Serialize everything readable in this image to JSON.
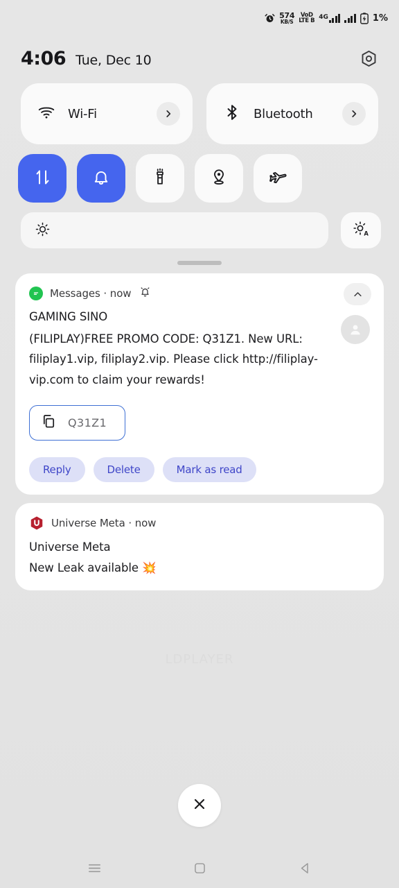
{
  "status_bar": {
    "alarm_icon": "alarm-clock-icon",
    "network_speed_value": "574",
    "network_speed_unit": "KB/S",
    "volte_line1": "VoD",
    "volte_line2": "LTE B",
    "network_type": "4G",
    "signal_icon_primary": "signal-bars-icon",
    "signal_icon_secondary": "signal-bars-icon",
    "battery_icon": "battery-charging-icon",
    "battery_level": "1%"
  },
  "header": {
    "time": "4:06",
    "date": "Tue, Dec 10",
    "settings_icon": "gear-icon"
  },
  "quick_settings": {
    "big_tiles": [
      {
        "label": "Wi-Fi",
        "icon": "wifi-icon",
        "active": false,
        "chevron_icon": "chevron-right-icon"
      },
      {
        "label": "Bluetooth",
        "icon": "bluetooth-icon",
        "active": false,
        "chevron_icon": "chevron-right-icon"
      }
    ],
    "toggles": [
      {
        "name": "mobile-data",
        "icon": "data-transfer-icon",
        "active": true
      },
      {
        "name": "ringer",
        "icon": "bell-icon",
        "active": true
      },
      {
        "name": "flashlight",
        "icon": "flashlight-icon",
        "active": false
      },
      {
        "name": "location",
        "icon": "location-pin-icon",
        "active": false
      },
      {
        "name": "airplane-mode",
        "icon": "airplane-icon",
        "active": false
      }
    ],
    "brightness": {
      "icon": "brightness-icon",
      "value_percent": 2,
      "auto_icon": "brightness-auto-icon"
    },
    "drag_handle": "drag-handle"
  },
  "notifications": [
    {
      "app_name": "Messages",
      "app_icon": "messages-icon",
      "time": "now",
      "alert_icon": "bell-ringing-icon",
      "collapse_icon": "chevron-up-icon",
      "title": "GAMING SINO",
      "body": "(FILIPLAY)FREE PROMO CODE: Q31Z1. New URL: filiplay1.vip, filiplay2.vip. Please click http://filiplay-vip.com to claim your rewards!",
      "avatar_icon": "person-avatar-icon",
      "copy_chip": {
        "icon": "copy-icon",
        "code": "Q31Z1"
      },
      "actions": [
        "Reply",
        "Delete",
        "Mark as read"
      ]
    },
    {
      "app_name": "Universe Meta",
      "app_icon": "universe-meta-icon",
      "time": "now",
      "title": "Universe Meta",
      "body": "New Leak available 💥"
    }
  ],
  "watermark": {
    "text": "LDPLAYER"
  },
  "clear_all": {
    "icon": "close-icon"
  },
  "nav_bar": {
    "recents_icon": "recents-menu-icon",
    "home_icon": "home-square-icon",
    "back_icon": "back-triangle-icon"
  },
  "colors": {
    "accent_blue": "#4565ee",
    "action_chip_bg": "#dde0f7",
    "action_chip_text": "#3f46c8",
    "messages_green": "#21c451",
    "universe_meta_red": "#b7202f",
    "shade_bg": "#e4e4e4",
    "card_bg": "#ffffff"
  }
}
